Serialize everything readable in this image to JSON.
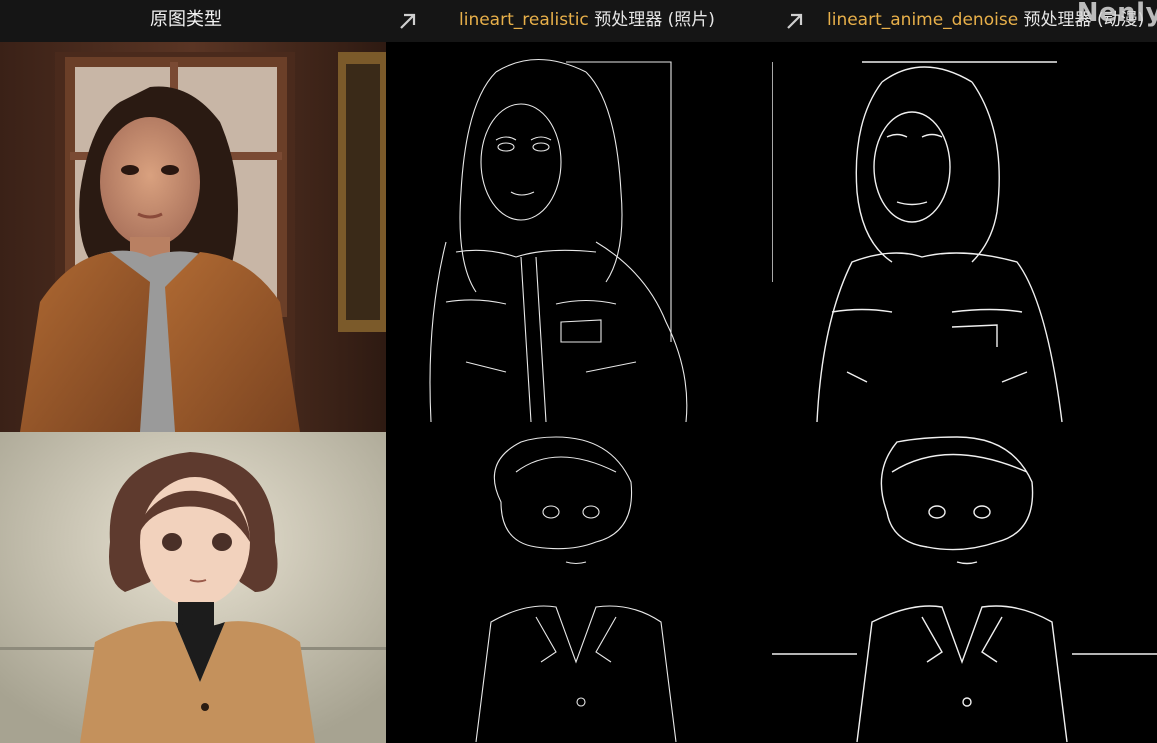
{
  "header": {
    "col1_label": "原图类型",
    "col2_name": "lineart_realistic",
    "col2_rest": " 预处理器 (照片)",
    "col3_name": "lineart_anime_denoise",
    "col3_rest": " 预处理器 (动漫)",
    "arrow_icon": "arrow-up-right-icon"
  },
  "watermark": "Nenly",
  "colors": {
    "header_bg": "#151515",
    "preprocessor_name": "#e8b04a",
    "label_text": "#e6e6e6",
    "lineart_bg": "#000000",
    "line_stroke": "#ffffff"
  }
}
